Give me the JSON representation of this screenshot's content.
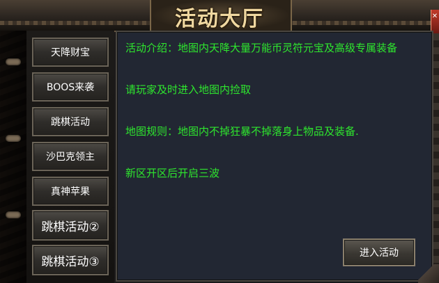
{
  "window": {
    "title": "活动大厅"
  },
  "sidebar": {
    "items": [
      {
        "label": "天降财宝"
      },
      {
        "label": "BOOS来袭"
      },
      {
        "label": "跳棋活动"
      },
      {
        "label": "沙巴克领主"
      },
      {
        "label": "真神苹果"
      },
      {
        "label": "跳棋活动②"
      },
      {
        "label": "跳棋活动③"
      }
    ]
  },
  "content": {
    "lines": [
      "活动介绍：地图内天降大量万能币灵符元宝及高级专属装备",
      "请玩家及时进入地图内捡取",
      "地图规则：地图内不掉狂暴不掉落身上物品及装备.",
      "新区开区后开启三波"
    ],
    "text_color": "#2ee62e",
    "enter_label": "进入活动"
  },
  "icons": {
    "close": "close-icon"
  }
}
